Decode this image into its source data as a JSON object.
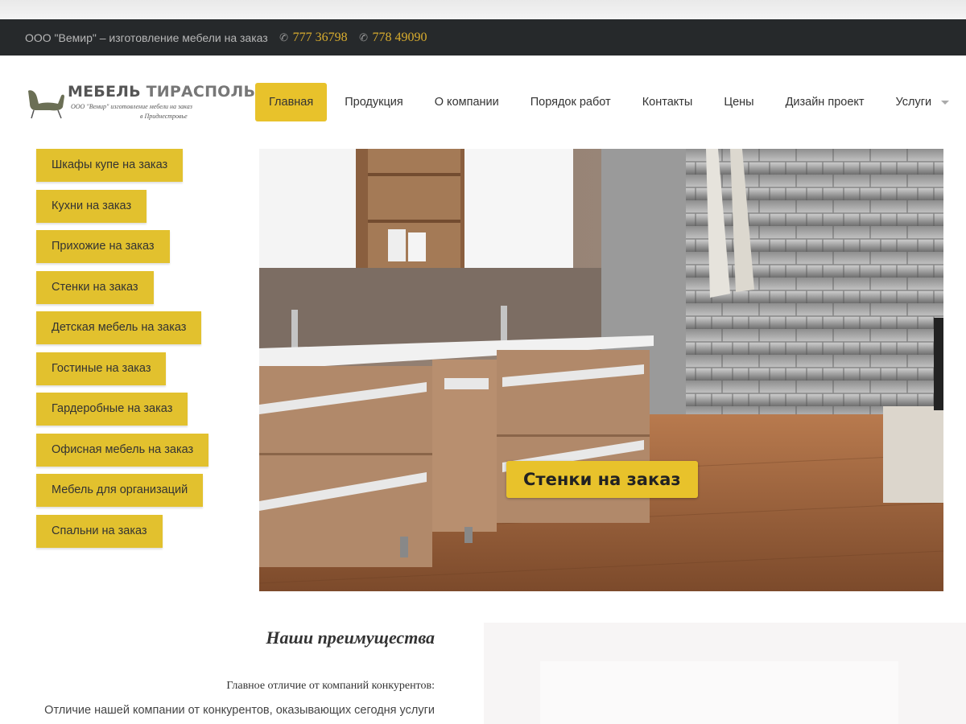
{
  "topbar": {
    "company": "ООО \"Вемир\" – изготовление мебели на заказ",
    "phones": [
      "777 36798",
      "778 49090"
    ],
    "phone_icon": "phone-icon"
  },
  "logo": {
    "title_part1": "МЕБЕЛЬ",
    "title_part2": "ТИРАСПОЛЬ",
    "subtitle_line1": "ООО \"Вемир\" изготовление мебели на заказ",
    "subtitle_line2": "в Приднестровье",
    "icon": "armchair-icon"
  },
  "nav": {
    "items": [
      {
        "label": "Главная",
        "active": true
      },
      {
        "label": "Продукция"
      },
      {
        "label": "О компании"
      },
      {
        "label": "Порядок работ"
      },
      {
        "label": "Контакты"
      },
      {
        "label": "Цены"
      },
      {
        "label": "Дизайн проект"
      },
      {
        "label": "Услуги",
        "has_dropdown": true
      }
    ]
  },
  "sidebar": {
    "categories": [
      "Шкафы купе на заказ",
      "Кухни на заказ",
      "Прихожие на заказ",
      "Стенки на заказ",
      "Детская мебель на заказ",
      "Гостиные на заказ",
      "Гардеробные на заказ",
      "Офисная мебель на заказ",
      "Мебель для организаций",
      "Спальни на заказ"
    ]
  },
  "hero": {
    "caption": "Стенки на заказ"
  },
  "advantages": {
    "title": "Наши преимущества",
    "subtitle": "Главное отличие от компаний конкурентов:",
    "text": "Отличие нашей компании от конкурентов, оказывающих сегодня услуги по"
  },
  "colors": {
    "accent": "#e8c22b",
    "topbar_bg": "#26292b",
    "phone": "#d9ad2e"
  }
}
